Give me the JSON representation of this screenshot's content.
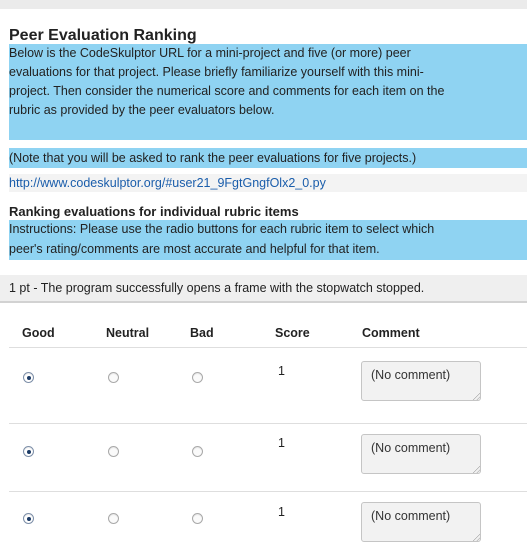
{
  "header": {
    "title": "Peer Evaluation Ranking"
  },
  "intro": {
    "line1": "Below is the CodeSkulptor URL for a mini-project and five (or more) peer",
    "line2": "evaluations for that project. Please briefly familiarize yourself with this mini-",
    "line3": "project. Then consider the numerical score and comments for each item on the",
    "line4": "rubric as provided by the peer evaluators below.",
    "note": "(Note that you will be asked to rank the peer evaluations for five projects.)"
  },
  "project_url": "http://www.codeskulptor.org/#user21_9FgtGngfOlx2_0.py",
  "ranking": {
    "heading": "Ranking evaluations for individual rubric items",
    "instructions_line1": "Instructions: Please use the radio buttons for each rubric item to select which",
    "instructions_line2": "peer's rating/comments are most accurate and helpful for that item."
  },
  "rubric_item": {
    "text": "1 pt - The program successfully opens a frame with the stopwatch stopped."
  },
  "table": {
    "columns": [
      "Good",
      "Neutral",
      "Bad",
      "Score",
      "Comment"
    ],
    "rows": [
      {
        "selected": "Good",
        "score": "1",
        "comment": "(No comment)"
      },
      {
        "selected": "Good",
        "score": "1",
        "comment": "(No comment)"
      },
      {
        "selected": "Good",
        "score": "1",
        "comment": "(No comment)"
      }
    ]
  },
  "colors": {
    "highlight": "#8fd3f2",
    "link": "#1a5dab"
  }
}
